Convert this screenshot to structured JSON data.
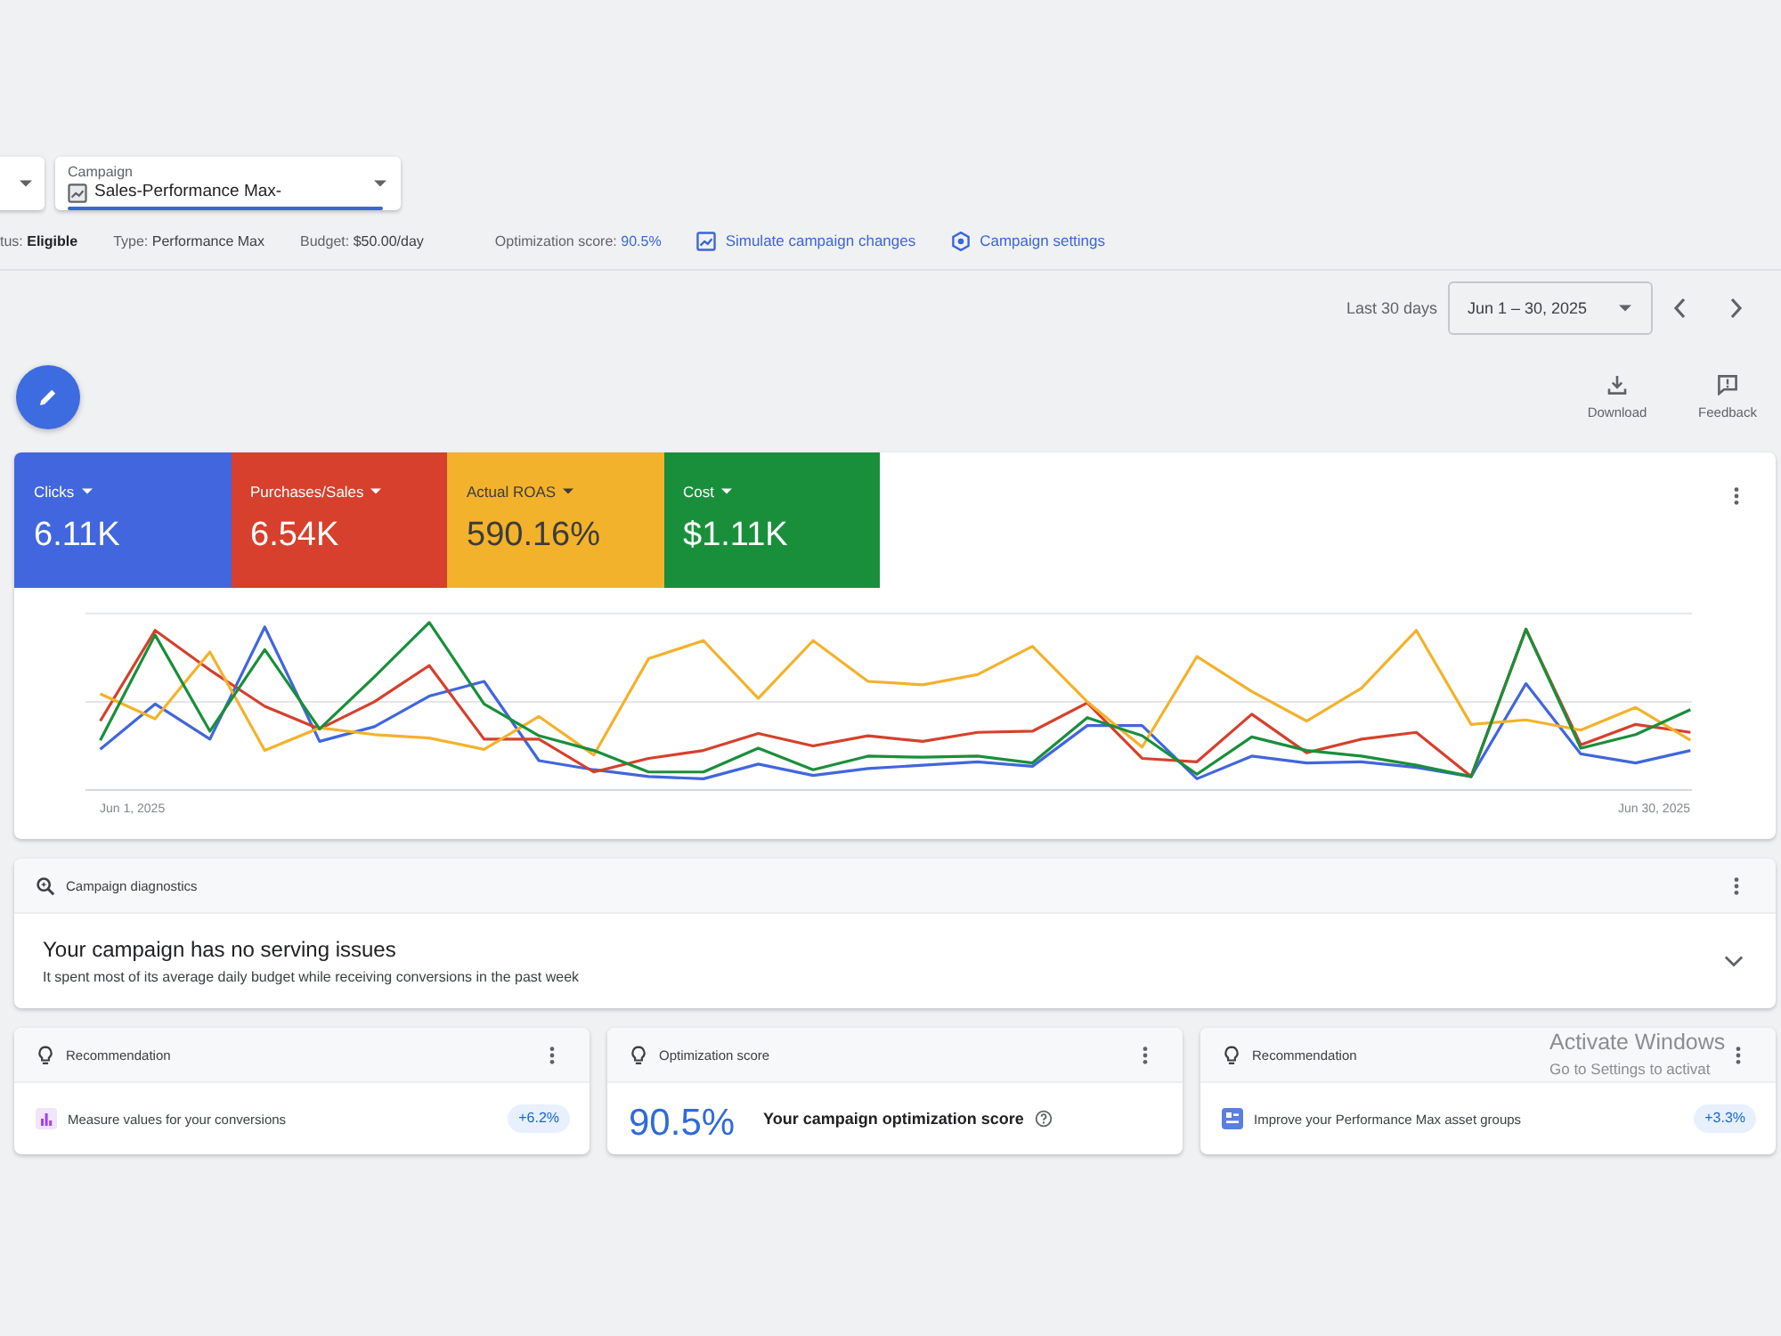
{
  "campaign_selector": {
    "label": "Campaign",
    "value": "Sales-Performance Max-"
  },
  "campaign_info": [
    {
      "kind": "status",
      "label": "tus:",
      "value": "Eligible"
    },
    {
      "kind": "plain",
      "label": "Type:",
      "value": "Performance Max"
    },
    {
      "kind": "plain",
      "label": "Budget:",
      "value": "$50.00/day"
    },
    {
      "kind": "score",
      "label": "Optimization score:",
      "value": "90.5%"
    }
  ],
  "links": [
    {
      "kind": "simulate",
      "label": "Simulate campaign changes"
    },
    {
      "kind": "settings",
      "label": "Campaign settings"
    }
  ],
  "date_range": {
    "preset": "Last 30 days",
    "value": "Jun 1 – 30, 2025"
  },
  "toolbar": [
    {
      "kind": "download",
      "label": "Download"
    },
    {
      "kind": "feedback",
      "label": "Feedback"
    }
  ],
  "metrics": [
    {
      "label": "Clicks",
      "value": "6.11K",
      "color": "#4166dd",
      "selected": true
    },
    {
      "label": "Purchases/Sales",
      "value": "6.54K",
      "color": "#d6402c",
      "selected": true
    },
    {
      "label": "Actual ROAS",
      "value": "590.16%",
      "color": "#f3b22b",
      "selected": true
    },
    {
      "label": "Cost",
      "value": "$1.11K",
      "color": "#198f3b",
      "selected": true
    }
  ],
  "chart": {
    "start_label": "Jun 1, 2025",
    "end_label": "Jun 30, 2025"
  },
  "diagnostics": {
    "title": "Campaign diagnostics",
    "heading": "Your campaign has no serving issues",
    "detail": "It spent most of its average daily budget while receiving conversions in the past week",
    "expanded": false
  },
  "cards": [
    {
      "kind": "recommendation",
      "title": "Recommendation",
      "item": "Measure values for your conversions",
      "badge": "+6.2%"
    },
    {
      "kind": "score",
      "title": "Optimization score",
      "score": "90.5%",
      "item": "Your campaign optimization score"
    },
    {
      "kind": "recommendation",
      "title": "Recommendation",
      "item": "Improve your Performance Max asset groups",
      "badge": "+3.3%"
    }
  ],
  "system_notice": {
    "title": "Activate Windows",
    "detail": "Go to Settings to activat"
  }
}
